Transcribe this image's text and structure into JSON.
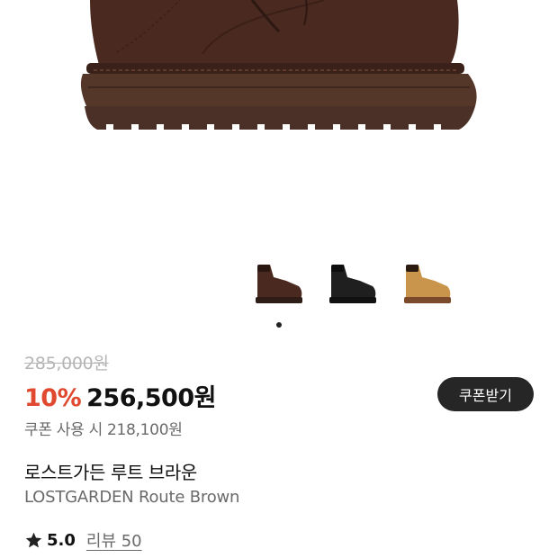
{
  "product": {
    "original_price": "285,000원",
    "discount_rate": "10%",
    "sale_price": "256,500원",
    "coupon_button_label": "쿠폰받기",
    "coupon_price_text": "쿠폰 사용 시 218,100원",
    "name": "로스트가든 루트 브라운",
    "name_en": "LOSTGARDEN Route Brown",
    "rating": "5.0",
    "review_link": "리뷰 50"
  },
  "gallery": {
    "thumbnails": [
      "boot-brown",
      "boot-black",
      "boot-tan"
    ],
    "current_index": 0,
    "page_count": 1
  },
  "colors": {
    "discount": "#e0492f",
    "button_bg": "#262626",
    "boot_brown": "#4a2a20",
    "boot_black": "#1f1f1f",
    "boot_tan": "#c9944b"
  }
}
